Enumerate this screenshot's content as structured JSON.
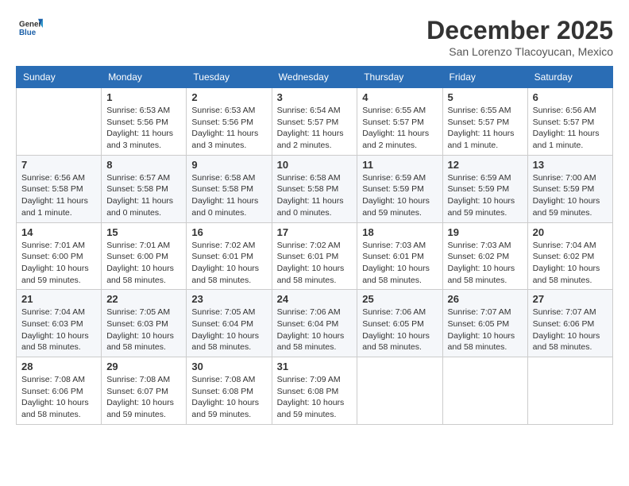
{
  "header": {
    "logo_line1": "General",
    "logo_line2": "Blue",
    "month": "December 2025",
    "location": "San Lorenzo Tlacoyucan, Mexico"
  },
  "days_of_week": [
    "Sunday",
    "Monday",
    "Tuesday",
    "Wednesday",
    "Thursday",
    "Friday",
    "Saturday"
  ],
  "weeks": [
    [
      {
        "day": "",
        "text": ""
      },
      {
        "day": "1",
        "text": "Sunrise: 6:53 AM\nSunset: 5:56 PM\nDaylight: 11 hours\nand 3 minutes."
      },
      {
        "day": "2",
        "text": "Sunrise: 6:53 AM\nSunset: 5:56 PM\nDaylight: 11 hours\nand 3 minutes."
      },
      {
        "day": "3",
        "text": "Sunrise: 6:54 AM\nSunset: 5:57 PM\nDaylight: 11 hours\nand 2 minutes."
      },
      {
        "day": "4",
        "text": "Sunrise: 6:55 AM\nSunset: 5:57 PM\nDaylight: 11 hours\nand 2 minutes."
      },
      {
        "day": "5",
        "text": "Sunrise: 6:55 AM\nSunset: 5:57 PM\nDaylight: 11 hours\nand 1 minute."
      },
      {
        "day": "6",
        "text": "Sunrise: 6:56 AM\nSunset: 5:57 PM\nDaylight: 11 hours\nand 1 minute."
      }
    ],
    [
      {
        "day": "7",
        "text": "Sunrise: 6:56 AM\nSunset: 5:58 PM\nDaylight: 11 hours\nand 1 minute."
      },
      {
        "day": "8",
        "text": "Sunrise: 6:57 AM\nSunset: 5:58 PM\nDaylight: 11 hours\nand 0 minutes."
      },
      {
        "day": "9",
        "text": "Sunrise: 6:58 AM\nSunset: 5:58 PM\nDaylight: 11 hours\nand 0 minutes."
      },
      {
        "day": "10",
        "text": "Sunrise: 6:58 AM\nSunset: 5:58 PM\nDaylight: 11 hours\nand 0 minutes."
      },
      {
        "day": "11",
        "text": "Sunrise: 6:59 AM\nSunset: 5:59 PM\nDaylight: 10 hours\nand 59 minutes."
      },
      {
        "day": "12",
        "text": "Sunrise: 6:59 AM\nSunset: 5:59 PM\nDaylight: 10 hours\nand 59 minutes."
      },
      {
        "day": "13",
        "text": "Sunrise: 7:00 AM\nSunset: 5:59 PM\nDaylight: 10 hours\nand 59 minutes."
      }
    ],
    [
      {
        "day": "14",
        "text": "Sunrise: 7:01 AM\nSunset: 6:00 PM\nDaylight: 10 hours\nand 59 minutes."
      },
      {
        "day": "15",
        "text": "Sunrise: 7:01 AM\nSunset: 6:00 PM\nDaylight: 10 hours\nand 58 minutes."
      },
      {
        "day": "16",
        "text": "Sunrise: 7:02 AM\nSunset: 6:01 PM\nDaylight: 10 hours\nand 58 minutes."
      },
      {
        "day": "17",
        "text": "Sunrise: 7:02 AM\nSunset: 6:01 PM\nDaylight: 10 hours\nand 58 minutes."
      },
      {
        "day": "18",
        "text": "Sunrise: 7:03 AM\nSunset: 6:01 PM\nDaylight: 10 hours\nand 58 minutes."
      },
      {
        "day": "19",
        "text": "Sunrise: 7:03 AM\nSunset: 6:02 PM\nDaylight: 10 hours\nand 58 minutes."
      },
      {
        "day": "20",
        "text": "Sunrise: 7:04 AM\nSunset: 6:02 PM\nDaylight: 10 hours\nand 58 minutes."
      }
    ],
    [
      {
        "day": "21",
        "text": "Sunrise: 7:04 AM\nSunset: 6:03 PM\nDaylight: 10 hours\nand 58 minutes."
      },
      {
        "day": "22",
        "text": "Sunrise: 7:05 AM\nSunset: 6:03 PM\nDaylight: 10 hours\nand 58 minutes."
      },
      {
        "day": "23",
        "text": "Sunrise: 7:05 AM\nSunset: 6:04 PM\nDaylight: 10 hours\nand 58 minutes."
      },
      {
        "day": "24",
        "text": "Sunrise: 7:06 AM\nSunset: 6:04 PM\nDaylight: 10 hours\nand 58 minutes."
      },
      {
        "day": "25",
        "text": "Sunrise: 7:06 AM\nSunset: 6:05 PM\nDaylight: 10 hours\nand 58 minutes."
      },
      {
        "day": "26",
        "text": "Sunrise: 7:07 AM\nSunset: 6:05 PM\nDaylight: 10 hours\nand 58 minutes."
      },
      {
        "day": "27",
        "text": "Sunrise: 7:07 AM\nSunset: 6:06 PM\nDaylight: 10 hours\nand 58 minutes."
      }
    ],
    [
      {
        "day": "28",
        "text": "Sunrise: 7:08 AM\nSunset: 6:06 PM\nDaylight: 10 hours\nand 58 minutes."
      },
      {
        "day": "29",
        "text": "Sunrise: 7:08 AM\nSunset: 6:07 PM\nDaylight: 10 hours\nand 59 minutes."
      },
      {
        "day": "30",
        "text": "Sunrise: 7:08 AM\nSunset: 6:08 PM\nDaylight: 10 hours\nand 59 minutes."
      },
      {
        "day": "31",
        "text": "Sunrise: 7:09 AM\nSunset: 6:08 PM\nDaylight: 10 hours\nand 59 minutes."
      },
      {
        "day": "",
        "text": ""
      },
      {
        "day": "",
        "text": ""
      },
      {
        "day": "",
        "text": ""
      }
    ]
  ]
}
